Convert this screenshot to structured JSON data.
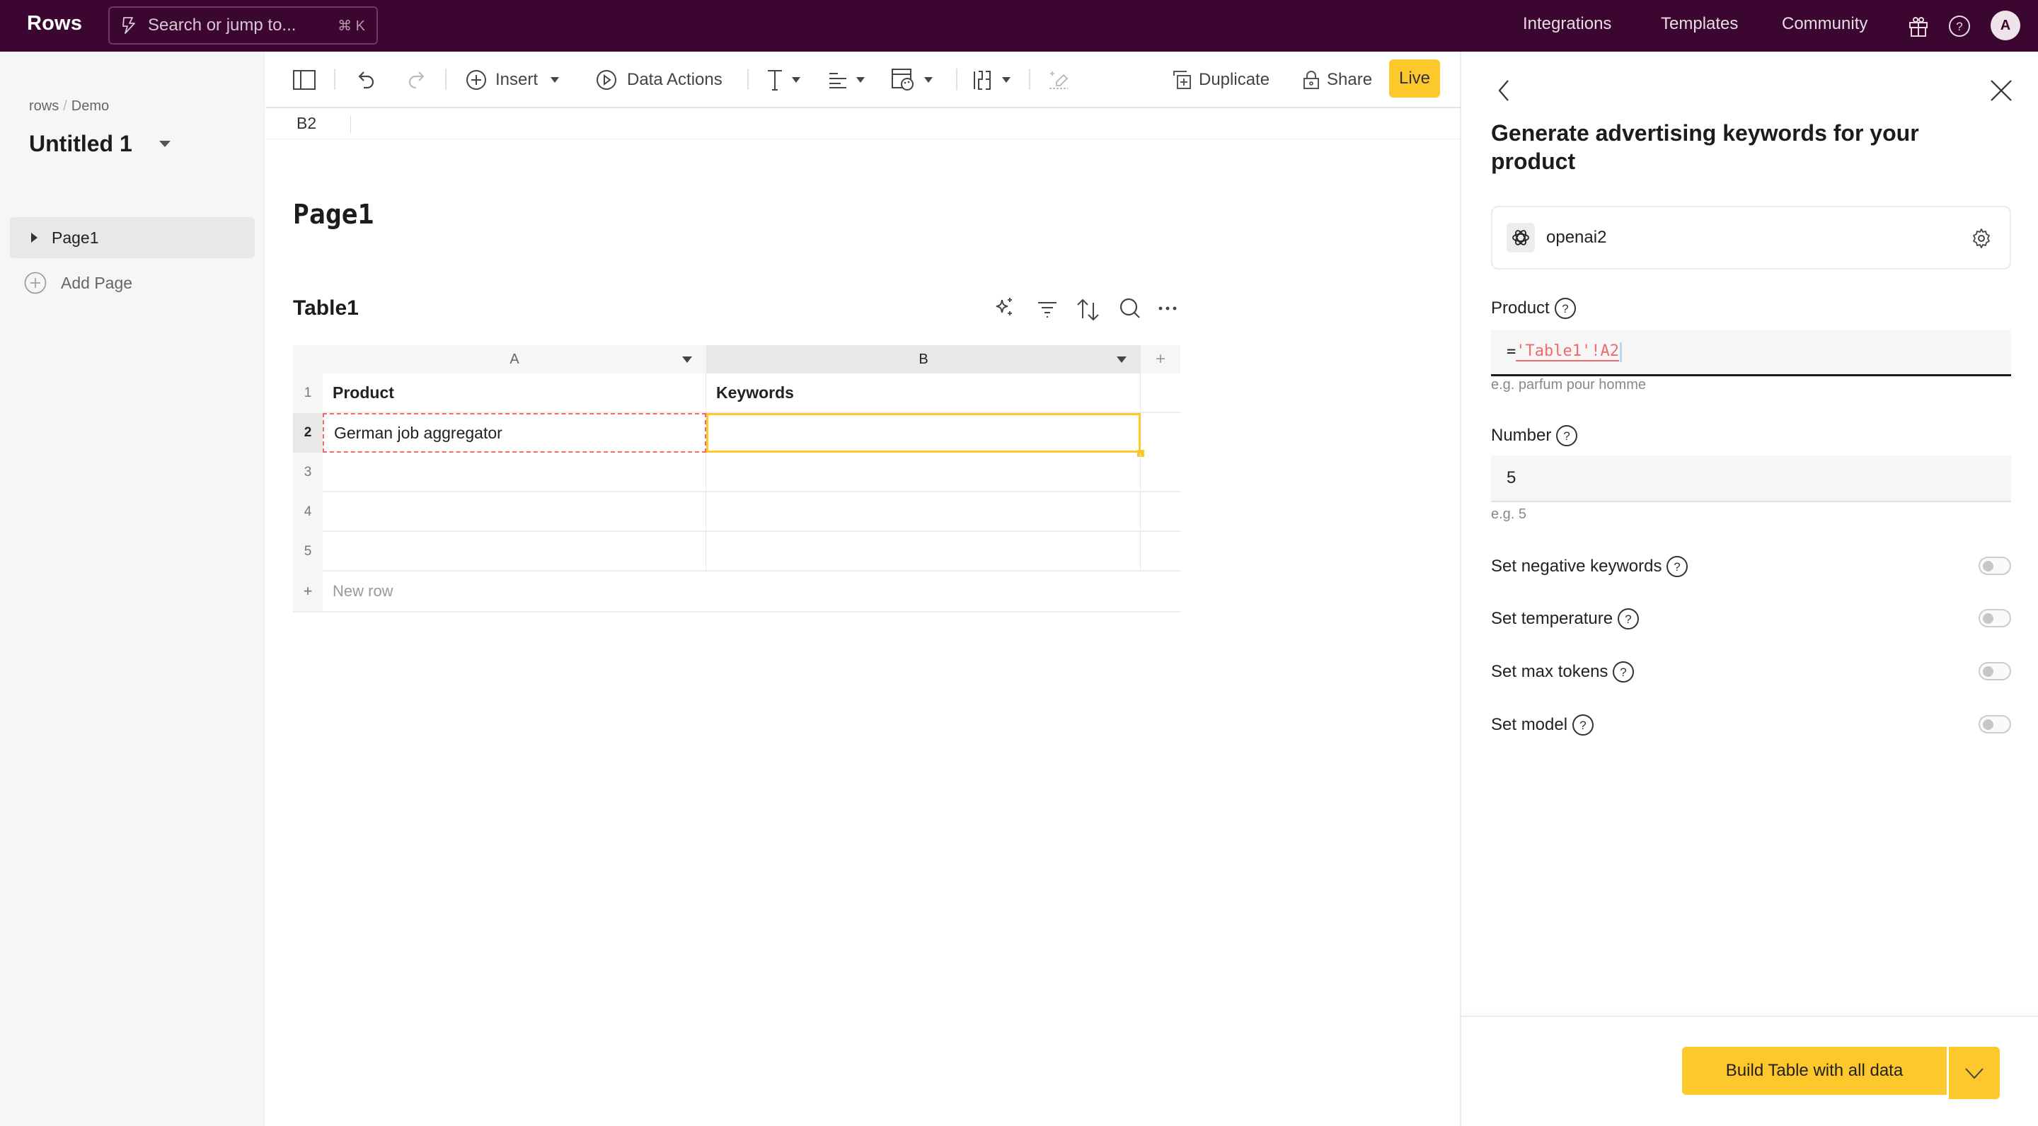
{
  "app": {
    "brand": "Rows",
    "search_placeholder": "Search or jump to...",
    "search_shortcut": "⌘ K",
    "nav_links": [
      "Integrations",
      "Templates",
      "Community"
    ],
    "avatar_initial": "A"
  },
  "sidebar": {
    "breadcrumb": [
      "rows",
      "Demo"
    ],
    "breadcrumb_separator": "/",
    "doc_title": "Untitled 1",
    "pages": [
      {
        "label": "Page1",
        "active": true
      }
    ],
    "add_page_label": "Add Page"
  },
  "toolbar": {
    "insert_label": "Insert",
    "data_actions_label": "Data Actions",
    "duplicate_label": "Duplicate",
    "share_label": "Share",
    "live_label": "Live"
  },
  "formula_bar": {
    "cell_ref": "B2"
  },
  "canvas": {
    "page_heading": "Page1",
    "table_title": "Table1",
    "columns": [
      "A",
      "B"
    ],
    "selected_column": "B",
    "row_numbers": [
      "1",
      "2",
      "3",
      "4",
      "5"
    ],
    "rows": [
      [
        "Product",
        "Keywords"
      ],
      [
        "German job aggregator",
        ""
      ],
      [
        "",
        ""
      ],
      [
        "",
        ""
      ],
      [
        "",
        ""
      ]
    ],
    "new_row_label": "New row",
    "add_column_label": "+",
    "add_row_label": "+"
  },
  "panel": {
    "title": "Generate advertising keywords for your product",
    "connection_name": "openai2",
    "fields": [
      {
        "label": "Product",
        "value_prefix": "=",
        "value_ref": "'Table1'!A2",
        "hint": "e.g. parfum pour homme"
      },
      {
        "label": "Number",
        "value": "5",
        "hint": "e.g. 5"
      }
    ],
    "toggles": [
      {
        "label": "Set negative keywords",
        "on": false
      },
      {
        "label": "Set temperature",
        "on": false
      },
      {
        "label": "Set max tokens",
        "on": false
      },
      {
        "label": "Set model",
        "on": false
      }
    ],
    "build_button_label": "Build Table with all data"
  },
  "colors": {
    "topbar_bg": "#3b0630",
    "accent_yellow": "#fdc82b",
    "reference_red": "#f06b6b"
  }
}
